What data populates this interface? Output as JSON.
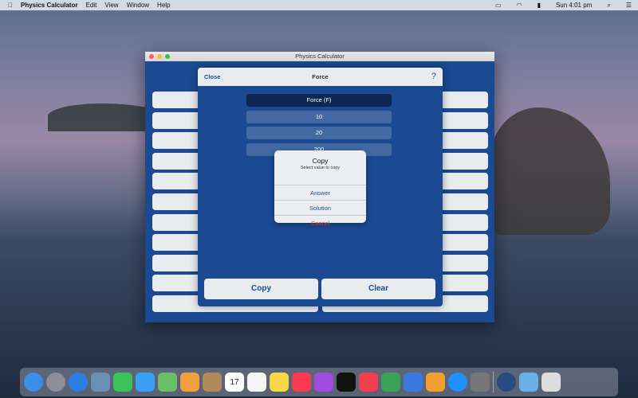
{
  "menubar": {
    "app": "Physics Calculator",
    "items": [
      "Edit",
      "View",
      "Window",
      "Help"
    ],
    "clock": "Sun 4:01 pm"
  },
  "window": {
    "title": "Physics Calculator"
  },
  "modal": {
    "close": "Close",
    "title": "Force",
    "help": "?",
    "fields": [
      "Force (F)",
      "10",
      "20",
      "200"
    ],
    "copy": "Copy",
    "clear": "Clear"
  },
  "alert": {
    "title": "Copy",
    "subtitle": "Select value to copy",
    "actions": [
      "Answer",
      "Solution",
      "Cancel"
    ]
  },
  "colors": {
    "primary": "#1b4a93",
    "cancel": "#e0332c"
  },
  "dock": {
    "apps": [
      "finder",
      "launchpad",
      "safari",
      "preview",
      "facetime",
      "messages",
      "maps",
      "photos",
      "contacts",
      "calendar",
      "reminders",
      "notes",
      "music",
      "podcasts",
      "tv",
      "news",
      "numbers",
      "keynote",
      "pages",
      "app-store",
      "system-preferences",
      "physics-calculator",
      "downloads-folder",
      "trash"
    ],
    "calendar_day": "17"
  }
}
